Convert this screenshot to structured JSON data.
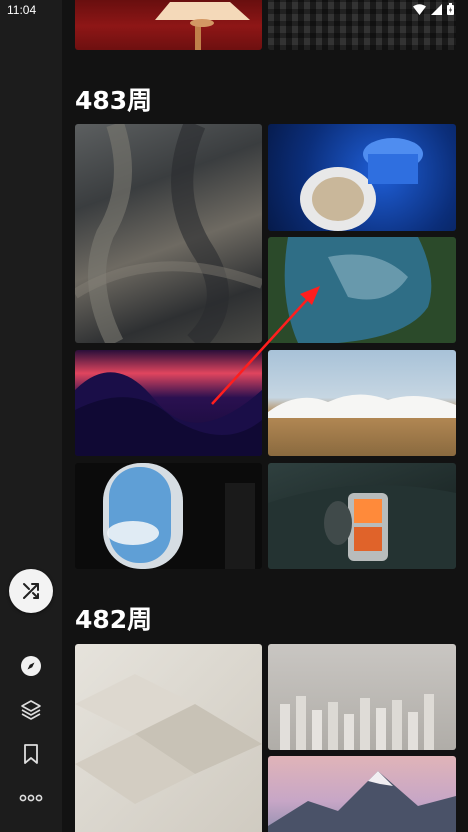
{
  "status_bar": {
    "time": "11:04"
  },
  "sections": [
    {
      "title": "483周"
    },
    {
      "title": "482周"
    }
  ],
  "nav": {
    "icons": [
      "shuffle-icon",
      "compass-icon",
      "layers-icon",
      "bookmark-icon",
      "more-icon"
    ]
  },
  "colors": {
    "background": "#121212",
    "rail": "#1c1c1c",
    "fab": "#f3f3f3"
  }
}
